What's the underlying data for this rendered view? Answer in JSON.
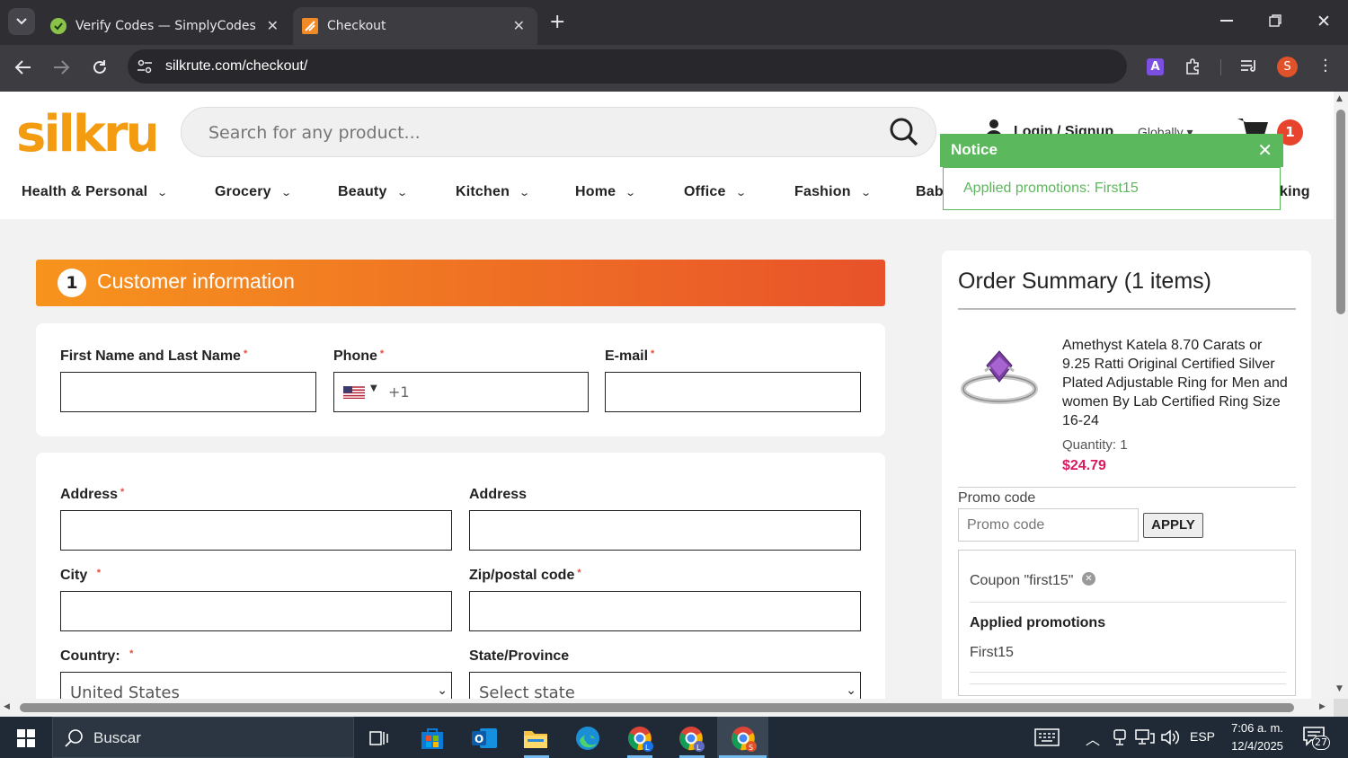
{
  "browser": {
    "tabs": [
      {
        "title": "Verify Codes — SimplyCodes",
        "active": false
      },
      {
        "title": "Checkout",
        "active": true
      }
    ],
    "url": "silkrute.com/checkout/",
    "profile_initial": "S",
    "extension_letter": "A"
  },
  "site": {
    "logo": "silkrute",
    "search_placeholder": "Search for any product...",
    "login_label": "Login / Signup",
    "globally_label": "Globally",
    "cart_count": "1",
    "nav": [
      {
        "label": "Health & Personal"
      },
      {
        "label": "Grocery"
      },
      {
        "label": "Beauty"
      },
      {
        "label": "Kitchen"
      },
      {
        "label": "Home"
      },
      {
        "label": "Office"
      },
      {
        "label": "Fashion"
      },
      {
        "label": "Bab"
      }
    ],
    "nav_tail": "king"
  },
  "notice": {
    "title": "Notice",
    "message": "Applied promotions: First15"
  },
  "checkout": {
    "step_number": "1",
    "step_title": "Customer information",
    "fields": {
      "name_label": "First Name and Last Name",
      "phone_label": "Phone",
      "phone_prefix": "+1",
      "email_label": "E-mail",
      "address_label": "Address",
      "address2_label": "Address",
      "city_label": "City",
      "zip_label": "Zip/postal code",
      "country_label": "Country:",
      "country_value": "United States",
      "state_label": "State/Province",
      "state_value": "Select state"
    },
    "required_mark": "*"
  },
  "order_summary": {
    "title": "Order Summary (1 items)",
    "item": {
      "name": "Amethyst Katela 8.70 Carats or 9.25 Ratti Original Certified Silver Plated Adjustable Ring for Men and women By Lab Certified Ring Size 16-24",
      "quantity": "Quantity: 1",
      "price": "$24.79"
    },
    "promo_label": "Promo code",
    "promo_placeholder": "Promo code",
    "apply_label": "APPLY",
    "coupon_text": "Coupon \"first15\"",
    "applied_title": "Applied promotions",
    "applied_value": "First15"
  },
  "taskbar": {
    "search_label": "Buscar",
    "language": "ESP",
    "time": "7:06 a. m.",
    "date": "12/4/2025",
    "notification_count": "27"
  },
  "colors": {
    "brand_orange": "#f39c12",
    "step_gradient_start": "#f7941d",
    "step_gradient_end": "#e8522a",
    "price_color": "#d81b60",
    "notice_green": "#5cb85c"
  }
}
